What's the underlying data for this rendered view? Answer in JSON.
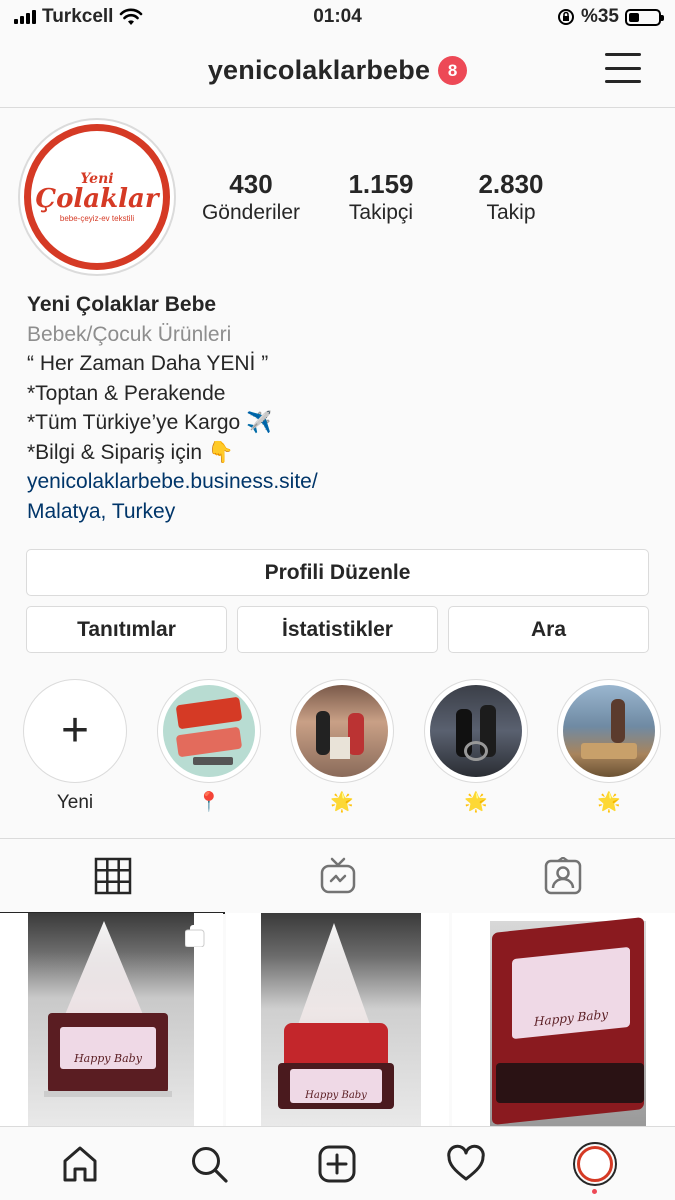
{
  "status_bar": {
    "carrier": "Turkcell",
    "time": "01:04",
    "battery_text": "%35",
    "battery_level": 0.35
  },
  "header": {
    "username": "yenicolaklarbebe",
    "notification_count": "8"
  },
  "avatar": {
    "brand_small": "Yeni",
    "brand_big": "Çolaklar",
    "tagline": "bebe-çeyiz-ev tekstili"
  },
  "stats": [
    {
      "value": "430",
      "label": "Gönderiler"
    },
    {
      "value": "1.159",
      "label": "Takipçi"
    },
    {
      "value": "2.830",
      "label": "Takip"
    }
  ],
  "bio": {
    "name": "Yeni Çolaklar Bebe",
    "category": "Bebek/Çocuk Ürünleri",
    "lines": [
      "“ Her Zaman Daha YENİ ”",
      "*Toptan & Perakende",
      "*Tüm Türkiye’ye Kargo ✈️",
      "*Bilgi & Sipariş için 👇"
    ],
    "website": "yenicolaklarbebe.business.site/",
    "location": "Malatya, Turkey"
  },
  "buttons": {
    "edit_profile": "Profili Düzenle",
    "promotions": "Tanıtımlar",
    "insights": "İstatistikler",
    "search": "Ara"
  },
  "highlights": [
    {
      "label": "Yeni",
      "kind": "new"
    },
    {
      "label": "📍",
      "kind": "logo"
    },
    {
      "label": "🌟",
      "kind": "photo"
    },
    {
      "label": "🌟",
      "kind": "photo"
    },
    {
      "label": "🌟",
      "kind": "photo"
    }
  ],
  "tabs": [
    "grid-icon",
    "igtv-icon",
    "tagged-icon"
  ],
  "grid_posts": [
    {
      "caption_art": "Happy Baby",
      "multi": true
    },
    {
      "caption_art": "Happy Baby",
      "multi": false
    },
    {
      "caption_art": "Happy Baby",
      "multi": false
    }
  ],
  "bottom_nav": [
    "home-icon",
    "search-icon",
    "add-post-icon",
    "activity-icon",
    "profile-avatar"
  ],
  "colors": {
    "brand_red": "#d53a25",
    "badge_red": "#ed4956",
    "link_blue": "#003569",
    "muted_gray": "#8e8e8e"
  }
}
